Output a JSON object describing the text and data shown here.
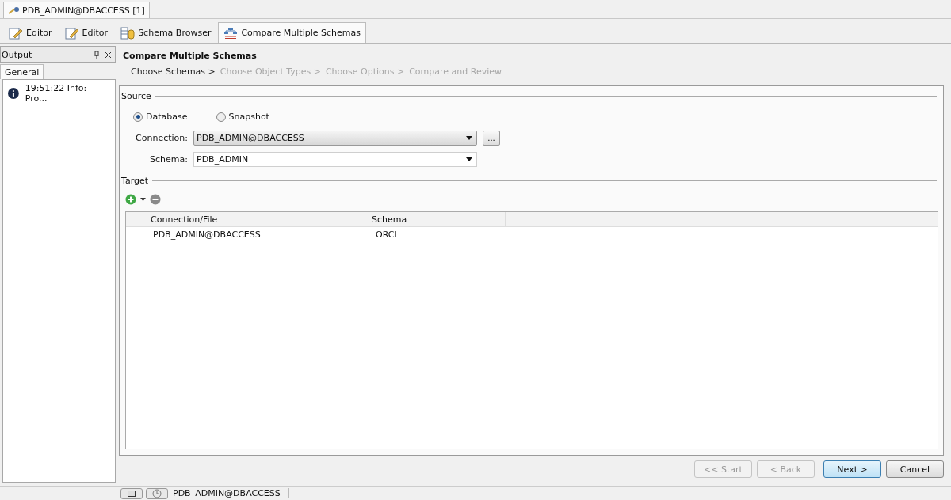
{
  "connection_tab": {
    "label": "PDB_ADMIN@DBACCESS [1]"
  },
  "editor_tabs": [
    {
      "label": "Editor",
      "kind": "editor",
      "selected": false
    },
    {
      "label": "Editor",
      "kind": "editor",
      "selected": false
    },
    {
      "label": "Schema Browser",
      "kind": "browser",
      "selected": false
    },
    {
      "label": "Compare Multiple Schemas",
      "kind": "compare",
      "selected": true
    }
  ],
  "output_panel": {
    "title": "Output",
    "tabs": [
      {
        "label": "General",
        "selected": true
      }
    ],
    "messages": [
      "19:51:22 Info: Pro..."
    ]
  },
  "wizard": {
    "title": "Compare Multiple Schemas",
    "steps": [
      {
        "label": "Choose Schemas >",
        "selected": true
      },
      {
        "label": "Choose Object Types >",
        "selected": false
      },
      {
        "label": "Choose Options >",
        "selected": false
      },
      {
        "label": "Compare and Review",
        "selected": false
      }
    ],
    "source": {
      "label": "Source",
      "options": [
        {
          "label": "Database",
          "selected": true
        },
        {
          "label": "Snapshot",
          "selected": false
        }
      ],
      "connection": {
        "label": "Connection:",
        "value": "PDB_ADMIN@DBACCESS",
        "browse": "..."
      },
      "schema": {
        "label": "Schema:",
        "value": "PDB_ADMIN"
      }
    },
    "target": {
      "label": "Target",
      "columns": [
        "Connection/File",
        "Schema"
      ],
      "rows": [
        [
          "PDB_ADMIN@DBACCESS",
          "ORCL"
        ]
      ]
    },
    "buttons": [
      {
        "label": "<< Start",
        "disabled": true,
        "default": false
      },
      {
        "label": "< Back",
        "disabled": true,
        "default": false
      },
      {
        "label": "Next >",
        "disabled": false,
        "default": true
      },
      {
        "label": "Cancel",
        "disabled": false,
        "default": false
      }
    ]
  },
  "status_bar": {
    "connection": "PDB_ADMIN@DBACCESS"
  }
}
